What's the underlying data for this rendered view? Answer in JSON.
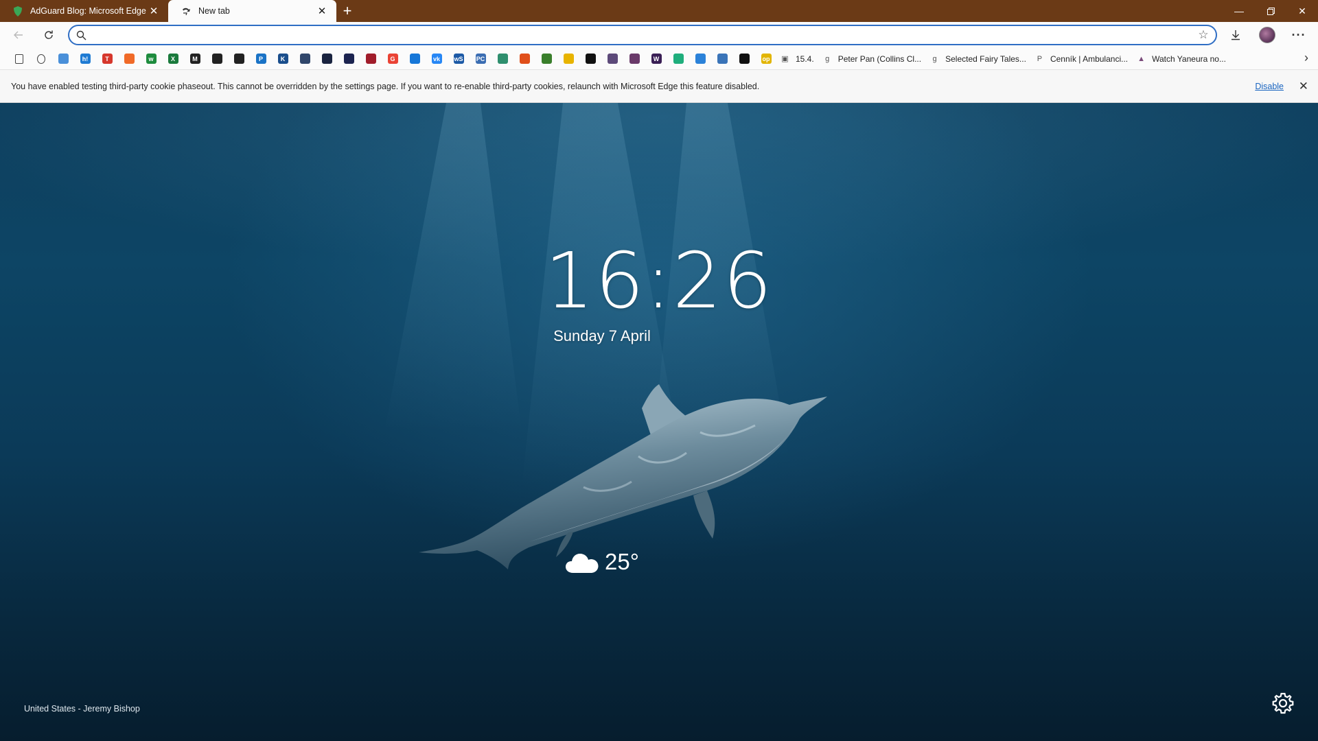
{
  "browser": {
    "tabs": [
      {
        "title": "AdGuard Blog: Microsoft Edge is",
        "active": false
      },
      {
        "title": "New tab",
        "active": true
      }
    ],
    "address_bar": {
      "value": "",
      "placeholder": ""
    },
    "window_controls": [
      "minimize",
      "restore",
      "close"
    ]
  },
  "favorites_bar": {
    "icon_items": [
      {
        "icon": "page-icon",
        "color": "#444"
      },
      {
        "icon": "history-icon",
        "color": "#444"
      },
      {
        "icon": "wave-icon",
        "color": "#4a90d9"
      },
      {
        "icon": "h-icon",
        "color": "#1f7bd3",
        "glyph": "h!"
      },
      {
        "icon": "t-icon",
        "color": "#d6372c",
        "glyph": "T"
      },
      {
        "icon": "fox-icon",
        "color": "#f06a28"
      },
      {
        "icon": "w-icon",
        "color": "#1e8c3e",
        "glyph": "w"
      },
      {
        "icon": "x-icon",
        "color": "#1a7a3c",
        "glyph": "X"
      },
      {
        "icon": "m-icon",
        "color": "#222",
        "glyph": "M"
      },
      {
        "icon": "pin-icon",
        "color": "#222"
      },
      {
        "icon": "calendar-icon",
        "color": "#222"
      },
      {
        "icon": "p-icon",
        "color": "#1a73c6",
        "glyph": "P"
      },
      {
        "icon": "k-icon",
        "color": "#1a4e8c",
        "glyph": "K"
      },
      {
        "icon": "news-icon",
        "color": "#31476b"
      },
      {
        "icon": "cube-icon",
        "color": "#1a2440"
      },
      {
        "icon": "moon-icon",
        "color": "#1c2450"
      },
      {
        "icon": "chart-icon",
        "color": "#a11d2b"
      },
      {
        "icon": "g-icon",
        "color": "#ea4335",
        "glyph": "G"
      },
      {
        "icon": "shield-icon",
        "color": "#1677d8"
      },
      {
        "icon": "vk-icon",
        "color": "#2787f5",
        "glyph": "vk"
      },
      {
        "icon": "ws-icon",
        "color": "#1d5aa6",
        "glyph": "wS"
      },
      {
        "icon": "pc-icon",
        "color": "#3b6db2",
        "glyph": "PC"
      },
      {
        "icon": "leaf-icon",
        "color": "#2f8f6e"
      },
      {
        "icon": "grid-icon",
        "color": "#e04f1a"
      },
      {
        "icon": "photo-icon",
        "color": "#3a7f2c"
      },
      {
        "icon": "bulb-icon",
        "color": "#e8b400"
      },
      {
        "icon": "github-icon",
        "color": "#111"
      },
      {
        "icon": "mountain-icon",
        "color": "#5d4a7a"
      },
      {
        "icon": "ship-icon",
        "color": "#6a3a6a"
      },
      {
        "icon": "w-dark-icon",
        "color": "#3a1f55",
        "glyph": "W"
      },
      {
        "icon": "play-icon",
        "color": "#1fae7c"
      },
      {
        "icon": "globe-icon",
        "color": "#2b82d9"
      },
      {
        "icon": "flower-icon",
        "color": "#3a74b8"
      },
      {
        "icon": "arrow-icon",
        "color": "#111"
      },
      {
        "icon": "op-icon",
        "color": "#e2b500",
        "glyph": "op"
      }
    ],
    "text_items": [
      {
        "icon": "calendar-icon",
        "label": "15.4."
      },
      {
        "icon": "g-icon",
        "label": "Peter Pan (Collins Cl..."
      },
      {
        "icon": "g-icon",
        "label": "Selected Fairy Tales..."
      },
      {
        "icon": "p-icon",
        "label": "Cenník | Ambulanci..."
      },
      {
        "icon": "ship-icon",
        "label": "Watch Yaneura no..."
      }
    ]
  },
  "infobar": {
    "message": "You have enabled testing third-party cookie phaseout. This cannot be overridden by the settings page. If you want to re-enable third-party cookies, relaunch with Microsoft Edge this feature disabled.",
    "action_label": "Disable"
  },
  "new_tab_page": {
    "time": "16:26",
    "date": "Sunday 7 April",
    "weather": {
      "icon": "cloud-icon",
      "temperature": "25°"
    },
    "image_credit": "United States - Jeremy Bishop",
    "background_colors": {
      "top": "#0e3f5e",
      "bottom": "#061d2e"
    }
  }
}
